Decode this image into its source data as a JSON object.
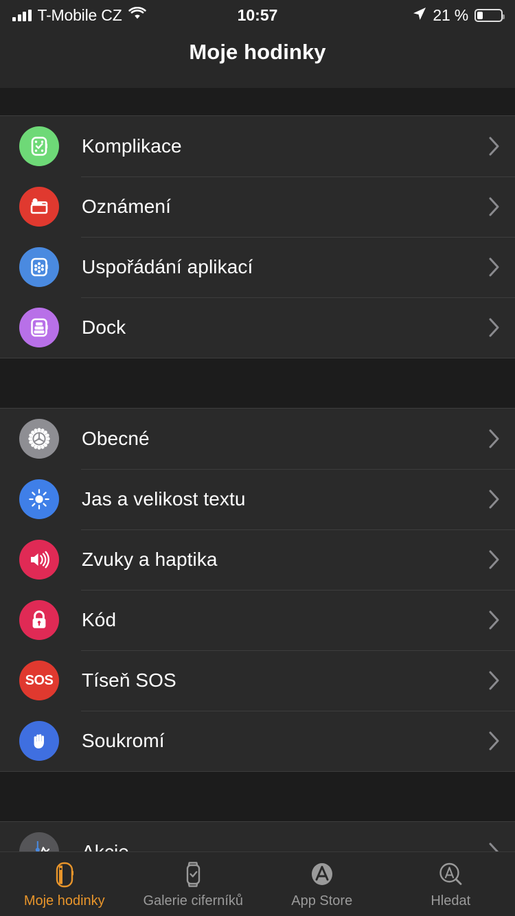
{
  "status_bar": {
    "carrier": "T-Mobile CZ",
    "time": "10:57",
    "battery_percent": "21 %",
    "battery_level": 25,
    "signal_icon": "cellular-bars-icon",
    "wifi_icon": "wifi-icon",
    "location_icon": "location-arrow-icon",
    "battery_icon": "battery-icon"
  },
  "header": {
    "title": "Moje hodinky"
  },
  "groups": [
    {
      "rows": [
        {
          "label": "Komplikace",
          "icon": "watch-complications-icon",
          "color": "#6ed977"
        },
        {
          "label": "Oznámení",
          "icon": "notifications-icon",
          "color": "#e0392f"
        },
        {
          "label": "Uspořádání aplikací",
          "icon": "app-layout-icon",
          "color": "#4a8ae0"
        },
        {
          "label": "Dock",
          "icon": "dock-icon",
          "color": "#b870e8"
        }
      ]
    },
    {
      "rows": [
        {
          "label": "Obecné",
          "icon": "gear-icon",
          "color": "#8e8e93"
        },
        {
          "label": "Jas a velikost textu",
          "icon": "brightness-sun-icon",
          "color": "#3f7fe8"
        },
        {
          "label": "Zvuky a haptika",
          "icon": "speaker-waves-icon",
          "color": "#e02a55"
        },
        {
          "label": "Kód",
          "icon": "lock-icon",
          "color": "#e02a55"
        },
        {
          "label": "Tíseň SOS",
          "icon": "sos-icon",
          "color": "#e0392f",
          "badge_text": "SOS"
        },
        {
          "label": "Soukromí",
          "icon": "privacy-hand-icon",
          "color": "#3f6fe0"
        }
      ]
    },
    {
      "rows": [
        {
          "label": "Akcie",
          "icon": "stocks-chart-icon",
          "color": "#555558"
        }
      ]
    }
  ],
  "tabs": [
    {
      "label": "Moje hodinky",
      "icon": "watch-icon",
      "active": true
    },
    {
      "label": "Galerie ciferníků",
      "icon": "watch-face-gallery-icon",
      "active": false
    },
    {
      "label": "App Store",
      "icon": "app-store-icon",
      "active": false
    },
    {
      "label": "Hledat",
      "icon": "search-app-store-icon",
      "active": false
    }
  ],
  "colors": {
    "accent": "#e8952b",
    "row_bg": "#2a2a2a",
    "page_bg": "#1c1c1c",
    "separator": "#3d3d3d"
  },
  "chevron_icon": "chevron-right-icon"
}
